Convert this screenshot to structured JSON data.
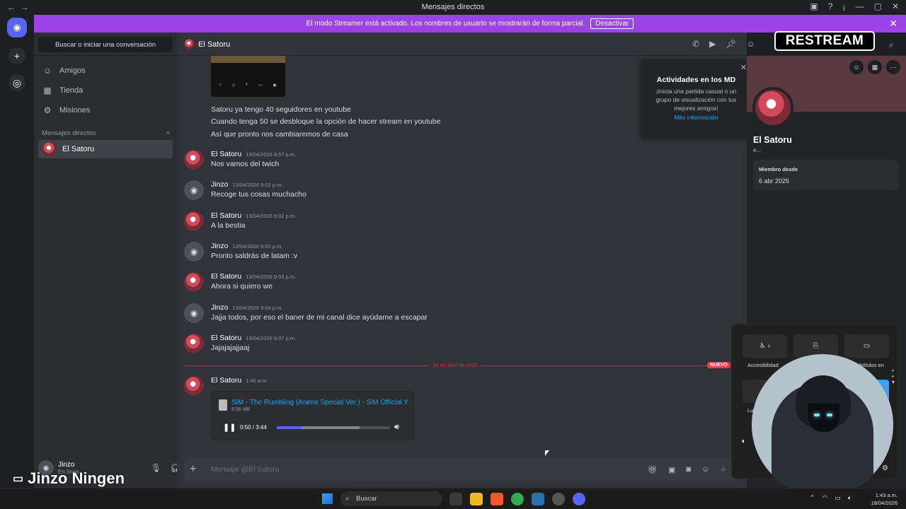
{
  "window": {
    "title": "Mensajes directos"
  },
  "banner": {
    "text": "El modo Streamer está activado. Los nombres de usuario se mostrarán de forma parcial.",
    "button": "Desactivar"
  },
  "sidebar": {
    "search": "Buscar o iniciar una conversación",
    "nav": [
      {
        "label": "Amigos",
        "icon": "friends-icon"
      },
      {
        "label": "Tienda",
        "icon": "store-icon"
      },
      {
        "label": "Misiones",
        "icon": "quests-icon"
      }
    ],
    "dm_header": "Mensajes directos",
    "dm_active": "El Satoru"
  },
  "user": {
    "name": "Jinzo",
    "status": "En línea",
    "overlay_name": "Jinzo Ningen"
  },
  "chat": {
    "title": "El Satoru",
    "lines": [
      "Satoru ya tengo 40 seguidores en youtube",
      "Cuando tenga 50 se desbloque la opción de hacer stream en youtube",
      "Así que pronto nos cambiaremos de casa"
    ],
    "messages": [
      {
        "author": "El Satoru",
        "time": "13/04/2026 8:57 p.m.",
        "text": "Nos vamos del twich",
        "avatar": "satoru"
      },
      {
        "author": "Jinzo",
        "time": "13/04/2026 9:02 p.m.",
        "text": "Recoge tus cosas muchacho",
        "avatar": "jinzo"
      },
      {
        "author": "El Satoru",
        "time": "13/04/2026 9:02 p.m.",
        "text": "A la bestia",
        "avatar": "satoru"
      },
      {
        "author": "Jinzo",
        "time": "13/04/2026 9:03 p.m.",
        "text": "Pronto saldrás de latam :v",
        "avatar": "jinzo"
      },
      {
        "author": "El Satoru",
        "time": "13/04/2026 9:03 p.m.",
        "text": "Ahora si quiero we",
        "avatar": "satoru"
      },
      {
        "author": "Jinzo",
        "time": "13/04/2026 9:04 p.m.",
        "text": "Jajja todos, por eso el baner de mi canal dice ayúdame a escapar",
        "avatar": "jinzo"
      },
      {
        "author": "El Satoru",
        "time": "13/04/2026 9:07 p.m.",
        "text": "Jajajajajjaaj",
        "avatar": "satoru"
      }
    ],
    "date_separator": "18 de abril de 2026",
    "new_badge": "NUEVO",
    "last_message": {
      "author": "El Satoru",
      "time": "1:40 a.m."
    },
    "attachment": {
      "file_name": "SiM - The Rumbling (Anime Special Ver.) - SiM Official Y",
      "file_size": "8.56 MB",
      "time": "0:50 / 3:44",
      "progress": 0.228,
      "buffered": 0.73
    },
    "composer_placeholder": "Mensaje @El Satoru"
  },
  "popup": {
    "title": "Actividades en los MD",
    "text": "¡Inicia una partida casual o un grupo de visualización con tus mejores amigos!",
    "link": "Más información"
  },
  "profile": {
    "name": "El Satoru",
    "tag": "e...",
    "member_since_label": "Miembro desde",
    "member_since": "6 abr 2026"
  },
  "overlay": {
    "logo": "RESTREAM"
  },
  "quick_settings": {
    "accessibility": "Accesibilidad",
    "captions": "ubtítulos en",
    "captions2": "o",
    "lu": "Lu"
  },
  "taskbar": {
    "search": "Buscar",
    "time": "1:43 a.m.",
    "date": "18/04/2026"
  },
  "colors": {
    "accent": "#5865f2",
    "streamer_banner": "#9a44e8",
    "new_red": "#e23d4e",
    "link": "#00a8fc"
  }
}
